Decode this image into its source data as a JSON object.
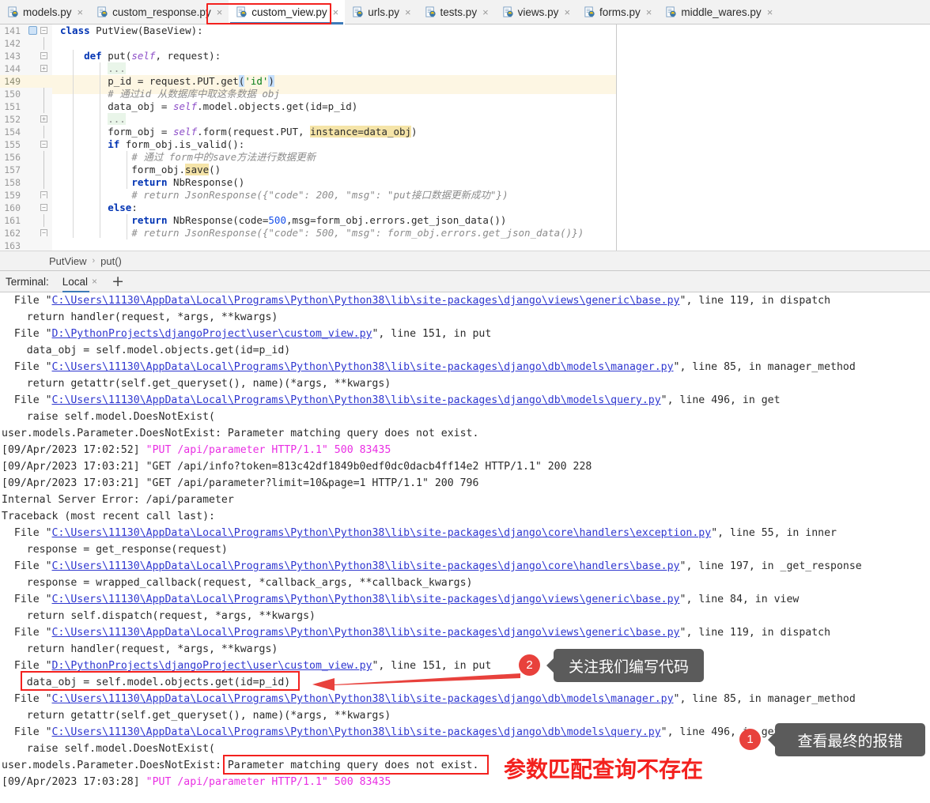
{
  "tabs": [
    {
      "label": "models.py",
      "active": false
    },
    {
      "label": "custom_response.py",
      "active": false
    },
    {
      "label": "custom_view.py",
      "active": true
    },
    {
      "label": "urls.py",
      "active": false
    },
    {
      "label": "tests.py",
      "active": false
    },
    {
      "label": "views.py",
      "active": false
    },
    {
      "label": "forms.py",
      "active": false
    },
    {
      "label": "middle_wares.py",
      "active": false
    }
  ],
  "tab_close_glyph": "×",
  "editor": {
    "line_numbers": [
      "141",
      "142",
      "143",
      "144",
      "149",
      "150",
      "151",
      "152",
      "154",
      "155",
      "156",
      "157",
      "158",
      "159",
      "160",
      "161",
      "162",
      "163"
    ],
    "current_line": "149",
    "lines": [
      "class PutView(BaseView):",
      "",
      "    def put(self, request):",
      "        ...",
      "        p_id = request.PUT.get('id')",
      "        # 通过id 从数据库中取这条数据 obj",
      "        data_obj = self.model.objects.get(id=p_id)",
      "        ...",
      "        form_obj = self.form(request.PUT, instance=data_obj)",
      "        if form_obj.is_valid():",
      "            # 通过 form中的save方法进行数据更新",
      "            form_obj.save()",
      "            return NbResponse()",
      "            # return JsonResponse({\"code\": 200, \"msg\": \"put接口数据更新成功\"})",
      "        else:",
      "            return NbResponse(code=500,msg=form_obj.errors.get_json_data())",
      "            # return JsonResponse({\"code\": 500, \"msg\": form_obj.errors.get_json_data()})",
      ""
    ]
  },
  "breadcrumb": {
    "class_name": "PutView",
    "separator": "›",
    "method_name": "put()"
  },
  "terminal": {
    "label": "Terminal:",
    "tab_label": "Local",
    "tab_close_glyph": "×",
    "add_glyph": "+",
    "lines": [
      "  File \"C:\\Users\\11130\\AppData\\Local\\Programs\\Python\\Python38\\lib\\site-packages\\django\\views\\generic\\base.py\", line 119, in dispatch",
      "    return handler(request, *args, **kwargs)",
      "  File \"D:\\PythonProjects\\djangoProject\\user\\custom_view.py\", line 151, in put",
      "    data_obj = self.model.objects.get(id=p_id)",
      "  File \"C:\\Users\\11130\\AppData\\Local\\Programs\\Python\\Python38\\lib\\site-packages\\django\\db\\models\\manager.py\", line 85, in manager_method",
      "    return getattr(self.get_queryset(), name)(*args, **kwargs)",
      "  File \"C:\\Users\\11130\\AppData\\Local\\Programs\\Python\\Python38\\lib\\site-packages\\django\\db\\models\\query.py\", line 496, in get",
      "    raise self.model.DoesNotExist(",
      "user.models.Parameter.DoesNotExist: Parameter matching query does not exist.",
      "[09/Apr/2023 17:02:52] \"PUT /api/parameter HTTP/1.1\" 500 83435",
      "[09/Apr/2023 17:03:21] \"GET /api/info?token=813c42df1849b0edf0dc0dacb4ff14e2 HTTP/1.1\" 200 228",
      "[09/Apr/2023 17:03:21] \"GET /api/parameter?limit=10&page=1 HTTP/1.1\" 200 796",
      "Internal Server Error: /api/parameter",
      "Traceback (most recent call last):",
      "  File \"C:\\Users\\11130\\AppData\\Local\\Programs\\Python\\Python38\\lib\\site-packages\\django\\core\\handlers\\exception.py\", line 55, in inner",
      "    response = get_response(request)",
      "  File \"C:\\Users\\11130\\AppData\\Local\\Programs\\Python\\Python38\\lib\\site-packages\\django\\core\\handlers\\base.py\", line 197, in _get_response",
      "    response = wrapped_callback(request, *callback_args, **callback_kwargs)",
      "  File \"C:\\Users\\11130\\AppData\\Local\\Programs\\Python\\Python38\\lib\\site-packages\\django\\views\\generic\\base.py\", line 84, in view",
      "    return self.dispatch(request, *args, **kwargs)",
      "  File \"C:\\Users\\11130\\AppData\\Local\\Programs\\Python\\Python38\\lib\\site-packages\\django\\views\\generic\\base.py\", line 119, in dispatch",
      "    return handler(request, *args, **kwargs)",
      "  File \"D:\\PythonProjects\\djangoProject\\user\\custom_view.py\", line 151, in put",
      "    data_obj = self.model.objects.get(id=p_id)",
      "  File \"C:\\Users\\11130\\AppData\\Local\\Programs\\Python\\Python38\\lib\\site-packages\\django\\db\\models\\manager.py\", line 85, in manager_method",
      "    return getattr(self.get_queryset(), name)(*args, **kwargs)",
      "  File \"C:\\Users\\11130\\AppData\\Local\\Programs\\Python\\Python38\\lib\\site-packages\\django\\db\\models\\query.py\", line 496, in get",
      "    raise self.model.DoesNotExist(",
      "user.models.Parameter.DoesNotExist: Parameter matching query does not exist.",
      "[09/Apr/2023 17:03:28] \"PUT /api/parameter HTTP/1.1\" 500 83435"
    ]
  },
  "annotations": {
    "badge_2": "2",
    "callout_2": "关注我们编写代码",
    "badge_1": "1",
    "callout_1": "查看最终的报错",
    "red_text_1": "参数匹配查询不存在"
  },
  "colors": {
    "accent_red": "#f3211e",
    "badge_red": "#e8413c",
    "callout_gray": "#5b5b5b",
    "link_blue": "#2f37d0",
    "magenta": "#e92fe3",
    "tab_underline": "#3d7ab8"
  }
}
